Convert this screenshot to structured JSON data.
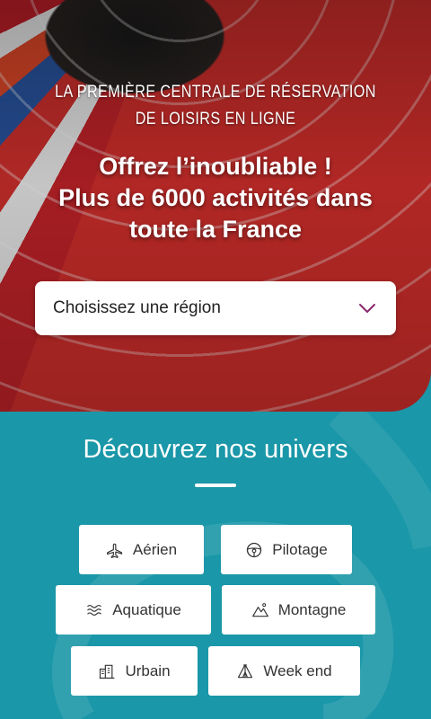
{
  "hero": {
    "tagline": "LA PREMIÈRE CENTRALE DE RÉSERVATION DE LOISIRS EN LIGNE",
    "headline_line1": "Offrez l’inoubliable !",
    "headline_line2": "Plus de 6000 activités dans",
    "headline_line3": "toute la France"
  },
  "region_select": {
    "placeholder": "Choisissez une région",
    "icon": "chevron-down-icon"
  },
  "universes": {
    "title": "Découvrez nos univers",
    "categories": [
      {
        "label": "Aérien",
        "icon": "plane-icon"
      },
      {
        "label": "Pilotage",
        "icon": "steering-wheel-icon"
      },
      {
        "label": "Aquatique",
        "icon": "waves-icon"
      },
      {
        "label": "Montagne",
        "icon": "mountain-icon"
      },
      {
        "label": "Urbain",
        "icon": "buildings-icon"
      },
      {
        "label": "Week end",
        "icon": "tent-icon"
      }
    ]
  },
  "colors": {
    "teal": "#1a97a8",
    "accent": "#8a2a6e"
  }
}
